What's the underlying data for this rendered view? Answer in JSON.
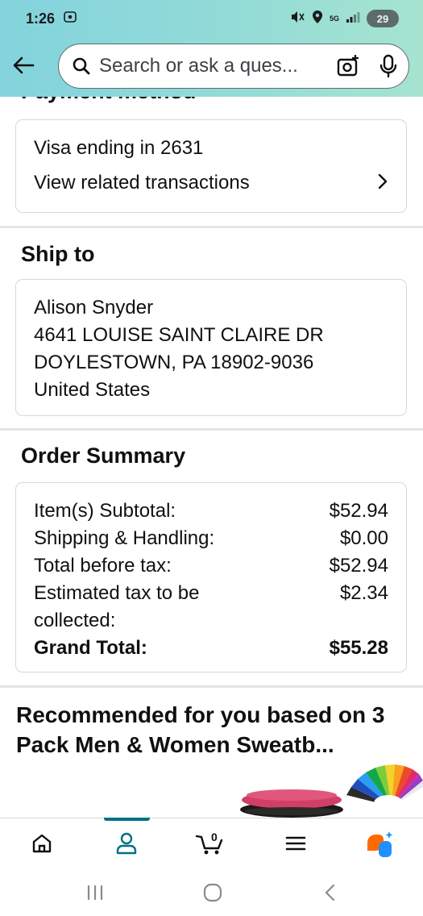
{
  "status_bar": {
    "time": "1:26",
    "network": "5G",
    "battery": "29"
  },
  "search": {
    "placeholder": "Search or ask a ques..."
  },
  "payment": {
    "heading": "Payment method",
    "card_text": "Visa ending in 2631",
    "transactions_link": "View related transactions"
  },
  "ship_to": {
    "heading": "Ship to",
    "name": "Alison Snyder",
    "street": "4641 LOUISE SAINT CLAIRE DR",
    "city_line": "DOYLESTOWN, PA 18902-9036",
    "country": "United States"
  },
  "order_summary": {
    "heading": "Order Summary",
    "rows": [
      {
        "label": "Item(s) Subtotal:",
        "value": "$52.94"
      },
      {
        "label": "Shipping & Handling:",
        "value": "$0.00"
      },
      {
        "label": "Total before tax:",
        "value": "$52.94"
      },
      {
        "label": "Estimated tax to be collected:",
        "value": "$2.34"
      }
    ],
    "grand_total_label": "Grand Total:",
    "grand_total_value": "$55.28"
  },
  "recommendations": {
    "title": "Recommended for you based on 3 Pack Men & Women Sweatb..."
  },
  "bottom_nav": {
    "items": [
      {
        "name": "home",
        "icon": "home-icon"
      },
      {
        "name": "account",
        "icon": "person-icon",
        "active": true
      },
      {
        "name": "cart",
        "icon": "cart-icon",
        "badge": "0"
      },
      {
        "name": "menu",
        "icon": "menu-icon"
      },
      {
        "name": "rufus",
        "icon": "rufus-icon"
      }
    ]
  },
  "colors": {
    "header_gradient_start": "#83d3dd",
    "header_gradient_end": "#a6e4cf",
    "active_tab": "#007185",
    "rufus_orange": "#ff6a00",
    "rufus_blue": "#1e90ff"
  }
}
